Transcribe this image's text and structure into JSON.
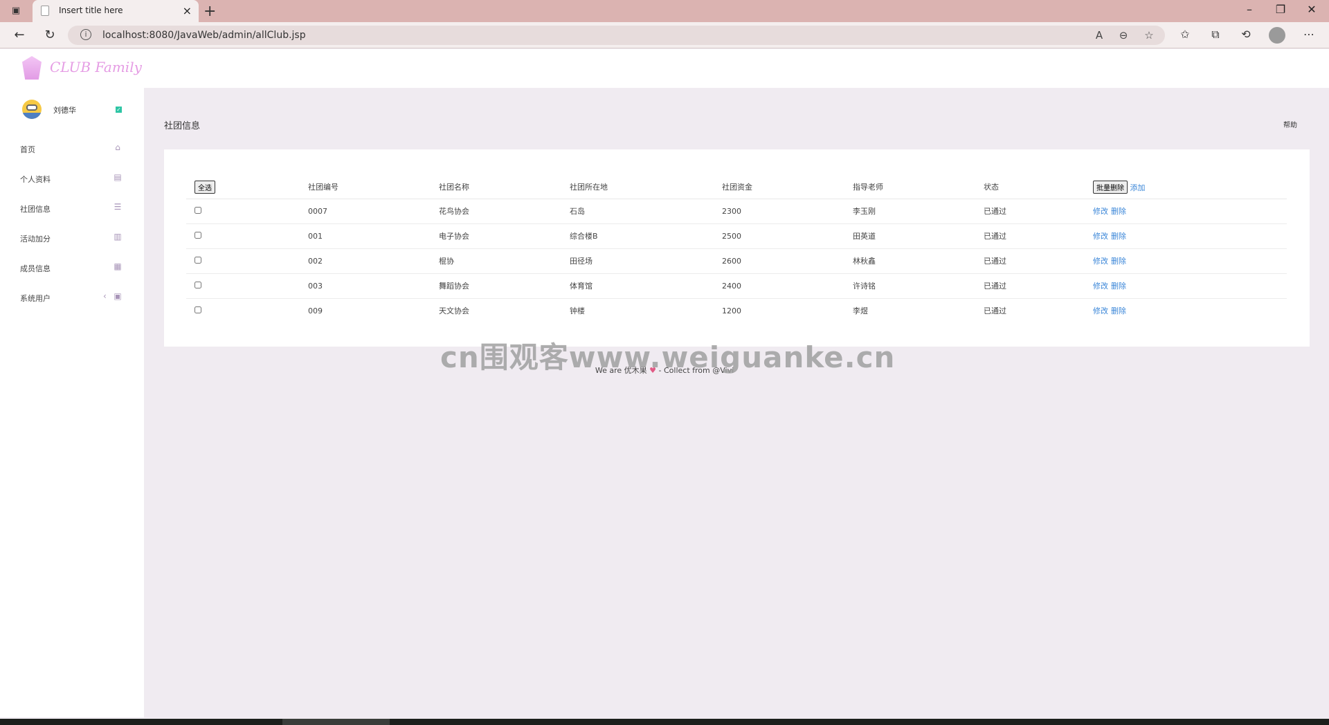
{
  "browser": {
    "tab_title": "Insert title here",
    "url": "localhost:8080/JavaWeb/admin/allClub.jsp",
    "new_tab": "+",
    "close_tab": "×"
  },
  "app": {
    "logo_text": "CLUB Family"
  },
  "user": {
    "name": "刘德华"
  },
  "sidebar": {
    "items": [
      {
        "label": "首页",
        "icon": "home-icon"
      },
      {
        "label": "个人资料",
        "icon": "profile-card-icon"
      },
      {
        "label": "社团信息",
        "icon": "list-icon"
      },
      {
        "label": "活动加分",
        "icon": "bar-chart-icon"
      },
      {
        "label": "成员信息",
        "icon": "table-icon"
      },
      {
        "label": "系统用户",
        "icon": "briefcase-icon"
      }
    ]
  },
  "main": {
    "title": "社团信息",
    "help": "帮助",
    "select_all": "全选",
    "batch_delete": "批量删除",
    "add": "添加",
    "headers": [
      "社团编号",
      "社团名称",
      "社团所在地",
      "社团资金",
      "指导老师",
      "状态"
    ],
    "edit_label": "修改",
    "delete_label": "删除",
    "rows": [
      {
        "id": "0007",
        "name": "花鸟协会",
        "location": "石岛",
        "funds": "2300",
        "teacher": "李玉刚",
        "status": "已通过"
      },
      {
        "id": "001",
        "name": "电子协会",
        "location": "综合楼B",
        "funds": "2500",
        "teacher": "田英道",
        "status": "已通过"
      },
      {
        "id": "002",
        "name": "棍协",
        "location": "田径场",
        "funds": "2600",
        "teacher": "林秋鑫",
        "status": "已通过"
      },
      {
        "id": "003",
        "name": "舞蹈协会",
        "location": "体育馆",
        "funds": "2400",
        "teacher": "许诗铭",
        "status": "已通过"
      },
      {
        "id": "009",
        "name": "天文协会",
        "location": "钟楼",
        "funds": "1200",
        "teacher": "李煜",
        "status": "已通过"
      }
    ]
  },
  "footer": {
    "prefix": "We are 优木果",
    "heart": "♥",
    "suffix": "- Collect from @Vivi"
  },
  "watermark": "cn围观客www.weiguanke.cn",
  "colors": {
    "accent": "#e59ce4",
    "link": "#3a86d8",
    "background": "#f0ebf1",
    "tabbar": "#dbb3b1"
  }
}
